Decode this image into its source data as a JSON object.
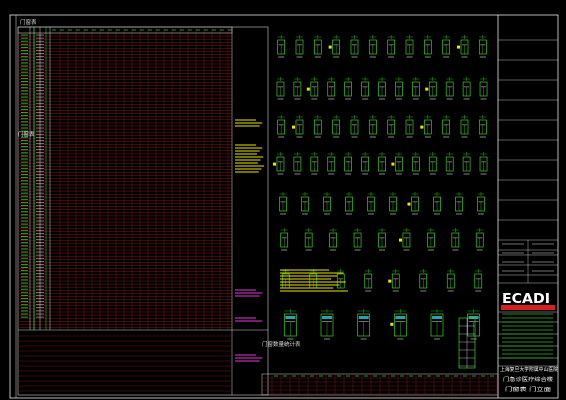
{
  "drawing": {
    "table_title": "门窗表",
    "table_title_2": "门窗表",
    "schedule_subtitle": "门窗数量统计表",
    "colors": {
      "frame": "#ffffff",
      "grid_red": "#8b1a1a",
      "grid_green": "#2db82d",
      "grid_white": "#cfcfcf",
      "elevation_green": "#39d11f",
      "elevation_yellow": "#f2e600",
      "elevation_cyan": "#34c9e0",
      "note_magenta": "#e23ad6",
      "note_yellow": "#e8e400",
      "logo_red": "#d71f1f"
    }
  },
  "title_block": {
    "logo": "ECADI",
    "project_line_1": "上海复旦大学附属中山医院",
    "project_line_2": "门急诊医疗综合楼",
    "sheet_name": "门窗表 门立面"
  },
  "elevation_rows": [
    {
      "count": 12
    },
    {
      "count": 13
    },
    {
      "count": 12
    },
    {
      "count": 13
    },
    {
      "count": 10
    },
    {
      "count": 9
    },
    {
      "count": 8
    },
    {
      "count": 6
    }
  ]
}
